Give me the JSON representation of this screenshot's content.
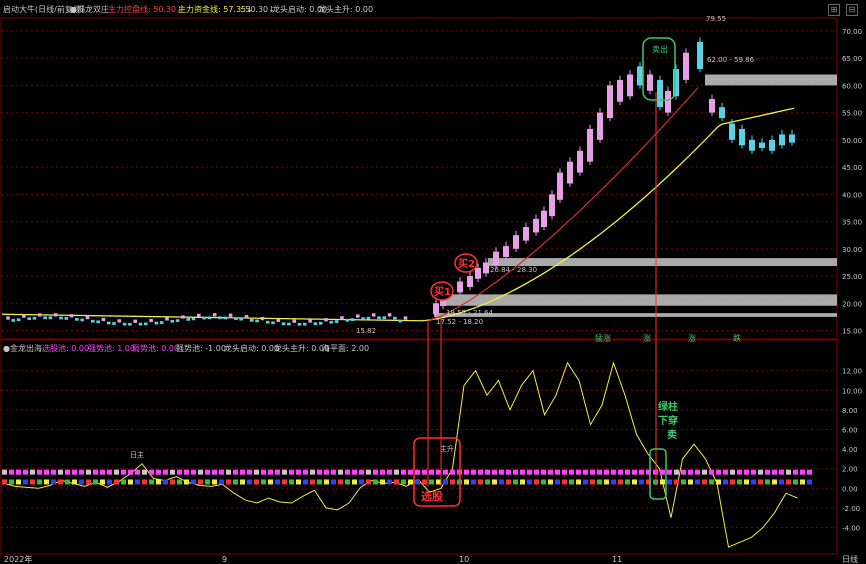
{
  "header": {
    "title": "启动大牛(日线/前复权)",
    "indicator": "●揭龙双庄",
    "line1": "主力控盘线: 50.30↓",
    "line2": "主力资金线: 57.35↓",
    "line3": ": 50.30↓",
    "line4": "龙头启动: 0.00",
    "line5": "龙头主升: 0.00"
  },
  "sub_header": {
    "title": "●金龙出海",
    "t1": "选股池: 0.00",
    "t2": "强势池: 1.00",
    "t3": "弱势池: 0.00",
    "t4": "强势池: -1.00",
    "t5": "龙头启动: 0.00",
    "t6": "龙头主升: 0.00",
    "t7": "海平面: 2.00"
  },
  "colors": {
    "up_candle": "#e6a0e6",
    "down_candle": "#5ad2e6",
    "ma_yellow": "#f0f040",
    "ma_red": "#d03030",
    "band_gray": "#c8c8c8",
    "green_box": "#3ec86a",
    "red_box": "#ff3030",
    "grid": "#7a0000"
  },
  "chart_data": [
    {
      "type": "candlestick",
      "y_axis_right": [
        "70.00",
        "65.00",
        "60.00",
        "55.00",
        "50.00",
        "45.00",
        "40.00",
        "35.00",
        "30.00",
        "25.00",
        "20.00",
        "15.00"
      ],
      "ylim": [
        14,
        72
      ],
      "price_labels": {
        "high": "79.55",
        "zone_top": "62.00 - 59.86",
        "zone_mid": "26.84 - 28.30",
        "zone_low": "19.55 - 21.64",
        "low_near": "17.52 - 18.20",
        "early_low": "15.82"
      },
      "annotations": {
        "buy1": "买1",
        "buy2": "买2",
        "sell_box": "卖出",
        "top_markers": [
          "猛涨",
          "涨",
          "涨",
          "跌"
        ]
      }
    },
    {
      "type": "line",
      "y_axis_right": [
        "12.00",
        "10.00",
        "8.00",
        "6.00",
        "4.00",
        "2.00",
        "0.00",
        "-2.00",
        "-4.00"
      ],
      "ylim": [
        -6.5,
        13.5
      ],
      "x_labels": [
        "2022年",
        "9",
        "10",
        "11",
        "日线"
      ],
      "annotations": {
        "select": "选股",
        "main_up": "主升",
        "green_pierce": [
          "绿柱",
          "下穿",
          "卖"
        ],
        "small": "日主"
      }
    }
  ]
}
